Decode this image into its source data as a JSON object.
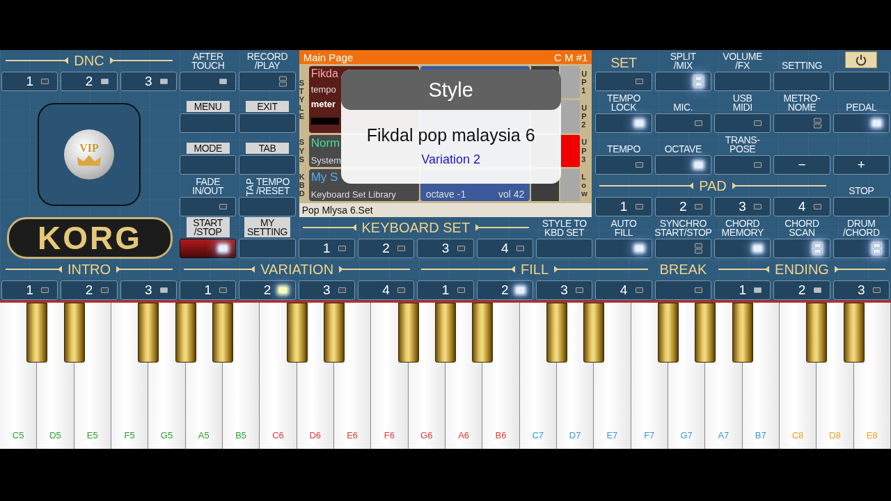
{
  "dnc": {
    "title": "DNC",
    "buttons": [
      {
        "text": "1",
        "lamp": true,
        "double": false,
        "bright": false,
        "lit": false
      },
      {
        "text": "2",
        "lamp": true,
        "double": false,
        "bright": true,
        "lit": false
      },
      {
        "text": "3",
        "lamp": true,
        "double": false,
        "bright": true,
        "lit": false
      }
    ]
  },
  "vip_badge": "VIP",
  "logo": "KORG",
  "system_buttons": [
    {
      "label": "AFTER\nTOUCH",
      "kind": "plain",
      "lamp": true,
      "double": false,
      "bright": true,
      "lit": false
    },
    {
      "label": "RECORD\n/PLAY",
      "kind": "plain",
      "lamp": true,
      "double": true,
      "lit": false
    },
    {
      "label": "MENU",
      "kind": "tab",
      "lamp": false,
      "lit": false
    },
    {
      "label": "EXIT",
      "kind": "tab",
      "lamp": false,
      "lit": false
    },
    {
      "label": "MODE",
      "kind": "tab",
      "lamp": false,
      "lit": false
    },
    {
      "label": "TAB",
      "kind": "tab",
      "lamp": false,
      "lit": false
    },
    {
      "label": "FADE\nIN/OUT",
      "kind": "plain",
      "lamp": true,
      "double": false,
      "bright": false,
      "lit": false
    },
    {
      "label": "TEMPO\n/RESET",
      "side_label": "TAP",
      "kind": "plain",
      "lamp": false,
      "lit": false
    },
    {
      "label": "START\n/STOP",
      "kind": "red-tab",
      "lamp": true,
      "double": false,
      "lit": true,
      "color": "#e8f0ff"
    },
    {
      "label": "MY\nSETTING",
      "kind": "tab",
      "lamp": false,
      "lit": false
    }
  ],
  "display": {
    "title": "Main Page",
    "code": "C M #1",
    "sections": [
      {
        "label": "STYLE",
        "kind": "style",
        "lines": [
          "Fikda",
          "tempo",
          "meter"
        ]
      },
      {
        "label": "SYS",
        "kind": "sys",
        "lines": [
          "Norm",
          "System"
        ]
      },
      {
        "label": "KBD",
        "kind": "kbd",
        "lines": [
          "My S",
          "Keyboard Set Library"
        ]
      }
    ],
    "parts": [
      {
        "label": "UP1",
        "selected": false
      },
      {
        "label": "UP2",
        "selected": false
      },
      {
        "label": "UP3",
        "selected": true
      },
      {
        "label": "Low",
        "selected": false,
        "octave": "octave -1",
        "volume": "vol 42"
      }
    ],
    "footer": "Pop Mlysa 6.Set"
  },
  "popup": {
    "title": "Style",
    "name": "Fikdal pop malaysia 6",
    "detail": "Variation 2"
  },
  "keyboard_set": {
    "title": "KEYBOARD SET",
    "buttons": [
      {
        "text": "1",
        "lamp": true,
        "double": false,
        "bright": false,
        "lit": false
      },
      {
        "text": "2",
        "lamp": true,
        "double": false,
        "bright": false,
        "lit": false
      },
      {
        "text": "3",
        "lamp": true,
        "double": false,
        "bright": false,
        "lit": false
      },
      {
        "text": "4",
        "lamp": true,
        "double": false,
        "bright": false,
        "lit": false
      }
    ]
  },
  "style_to_kbd": {
    "label": "STYLE TO\nKBD SET",
    "lamp": false,
    "lit": false
  },
  "right_buttons": [
    {
      "label": "SET",
      "kind": "gold",
      "lamp": true,
      "double": false,
      "bright": false,
      "lit": false
    },
    {
      "label": "SPLIT\n/MIX",
      "kind": "plain",
      "lamp": true,
      "double": true,
      "lit": true,
      "color": "#e6f0ff"
    },
    {
      "label": "VOLUME\n/FX",
      "kind": "plain",
      "lamp": false,
      "lit": false
    },
    {
      "label": "SETTING",
      "kind": "plain",
      "lamp": false,
      "lit": false
    },
    {
      "kind": "power",
      "lamp": false,
      "lit": false
    },
    {
      "label": "TEMPO\nLOCK",
      "kind": "plain",
      "lamp": true,
      "double": false,
      "lit": true,
      "color": "#e6f0ff"
    },
    {
      "label": "MIC.",
      "kind": "plain",
      "lamp": true,
      "double": false,
      "bright": false,
      "lit": false
    },
    {
      "label": "USB\nMIDI",
      "kind": "plain",
      "lamp": true,
      "double": false,
      "bright": false,
      "lit": false
    },
    {
      "label": "METRO-\nNOME",
      "kind": "plain",
      "lamp": true,
      "double": true,
      "lit": false
    },
    {
      "label": "PEDAL",
      "kind": "plain",
      "lamp": true,
      "double": false,
      "lit": true,
      "color": "#e6f0ff"
    },
    {
      "label": "TEMPO",
      "kind": "plain",
      "lamp": true,
      "double": false,
      "bright": false,
      "lit": false
    },
    {
      "label": "OCTAVE",
      "kind": "plain",
      "lamp": true,
      "double": false,
      "lit": true,
      "color": "#e6f0ff"
    },
    {
      "label": "TRANS-\nPOSE",
      "kind": "plain",
      "lamp": true,
      "double": false,
      "bright": false,
      "lit": false
    },
    {
      "text": "−",
      "kind": "plain",
      "lamp": false,
      "lit": false
    },
    {
      "text": "+",
      "kind": "plain",
      "lamp": false,
      "lit": false
    }
  ],
  "pad": {
    "title": "PAD",
    "buttons": [
      {
        "text": "1",
        "lamp": true,
        "double": false,
        "bright": false,
        "lit": false
      },
      {
        "text": "2",
        "lamp": true,
        "double": false,
        "bright": false,
        "lit": false
      },
      {
        "text": "3",
        "lamp": true,
        "double": false,
        "bright": false,
        "lit": false
      },
      {
        "text": "4",
        "lamp": true,
        "double": false,
        "bright": false,
        "lit": false
      }
    ]
  },
  "stop": {
    "label": "STOP",
    "lamp": false,
    "lit": false
  },
  "right_bottom": [
    {
      "label": "AUTO\nFILL",
      "lamp": true,
      "double": false,
      "lit": true,
      "color": "#e6f0ff"
    },
    {
      "label": "SYNCHRO\nSTART/STOP",
      "lamp": true,
      "double": true,
      "lit": false
    },
    {
      "label": "CHORD\nMEMORY",
      "lamp": true,
      "double": false,
      "lit": true,
      "color": "#e6f0ff"
    },
    {
      "label": "CHORD\nSCAN",
      "lamp": true,
      "double": true,
      "lit": true,
      "color": "#e6f0ff"
    },
    {
      "label": "DRUM\n/CHORD",
      "lamp": true,
      "double": true,
      "lit": true,
      "color": "#e6f0ff"
    }
  ],
  "style_groups": [
    {
      "title": "INTRO",
      "buttons": [
        {
          "text": "1",
          "lamp": true,
          "double": false,
          "bright": false,
          "lit": false
        },
        {
          "text": "2",
          "lamp": true,
          "double": false,
          "bright": false,
          "lit": false
        },
        {
          "text": "3",
          "lamp": true,
          "double": false,
          "bright": true,
          "lit": false
        }
      ]
    },
    {
      "title": "VARIATION",
      "buttons": [
        {
          "text": "1",
          "lamp": true,
          "double": false,
          "bright": false,
          "lit": false
        },
        {
          "text": "2",
          "lamp": true,
          "double": false,
          "lit": true,
          "color": "#f6ffb8"
        },
        {
          "text": "3",
          "lamp": true,
          "double": false,
          "bright": false,
          "lit": false
        },
        {
          "text": "4",
          "lamp": true,
          "double": false,
          "bright": false,
          "lit": false
        }
      ]
    },
    {
      "title": "FILL",
      "buttons": [
        {
          "text": "1",
          "lamp": true,
          "double": false,
          "bright": false,
          "lit": false
        },
        {
          "text": "2",
          "lamp": true,
          "double": false,
          "lit": true,
          "color": "#e6f0ff"
        },
        {
          "text": "3",
          "lamp": true,
          "double": false,
          "bright": false,
          "lit": false
        },
        {
          "text": "4",
          "lamp": true,
          "double": false,
          "bright": false,
          "lit": false
        }
      ]
    },
    {
      "title": "BREAK",
      "buttons": [
        {
          "lamp": true,
          "double": false,
          "bright": false,
          "lit": false
        }
      ]
    },
    {
      "title": "ENDING",
      "buttons": [
        {
          "text": "1",
          "lamp": true,
          "double": false,
          "bright": true,
          "lit": false
        },
        {
          "text": "2",
          "lamp": true,
          "double": false,
          "bright": true,
          "lit": false
        },
        {
          "text": "3",
          "lamp": true,
          "double": false,
          "bright": false,
          "lit": false
        }
      ]
    }
  ],
  "keys": [
    {
      "label": "C5",
      "color": "#2e9e2e"
    },
    {
      "label": "D5",
      "color": "#2e9e2e"
    },
    {
      "label": "E5",
      "color": "#2e9e2e"
    },
    {
      "label": "F5",
      "color": "#2e9e2e"
    },
    {
      "label": "G5",
      "color": "#2e9e2e"
    },
    {
      "label": "A5",
      "color": "#2e9e2e"
    },
    {
      "label": "B5",
      "color": "#2e9e2e"
    },
    {
      "label": "C6",
      "color": "#e03c3c"
    },
    {
      "label": "D6",
      "color": "#e03c3c"
    },
    {
      "label": "E6",
      "color": "#e03c3c"
    },
    {
      "label": "F6",
      "color": "#e03c3c"
    },
    {
      "label": "G6",
      "color": "#e03c3c"
    },
    {
      "label": "A6",
      "color": "#e03c3c"
    },
    {
      "label": "B6",
      "color": "#e03c3c"
    },
    {
      "label": "C7",
      "color": "#3a9ad0"
    },
    {
      "label": "D7",
      "color": "#3a9ad0"
    },
    {
      "label": "E7",
      "color": "#3a9ad0"
    },
    {
      "label": "F7",
      "color": "#3a9ad0"
    },
    {
      "label": "G7",
      "color": "#3a9ad0"
    },
    {
      "label": "A7",
      "color": "#3a9ad0"
    },
    {
      "label": "B7",
      "color": "#3a9ad0"
    },
    {
      "label": "C8",
      "color": "#f0a020"
    },
    {
      "label": "D8",
      "color": "#f0a020"
    },
    {
      "label": "E8",
      "color": "#f0a020"
    }
  ]
}
